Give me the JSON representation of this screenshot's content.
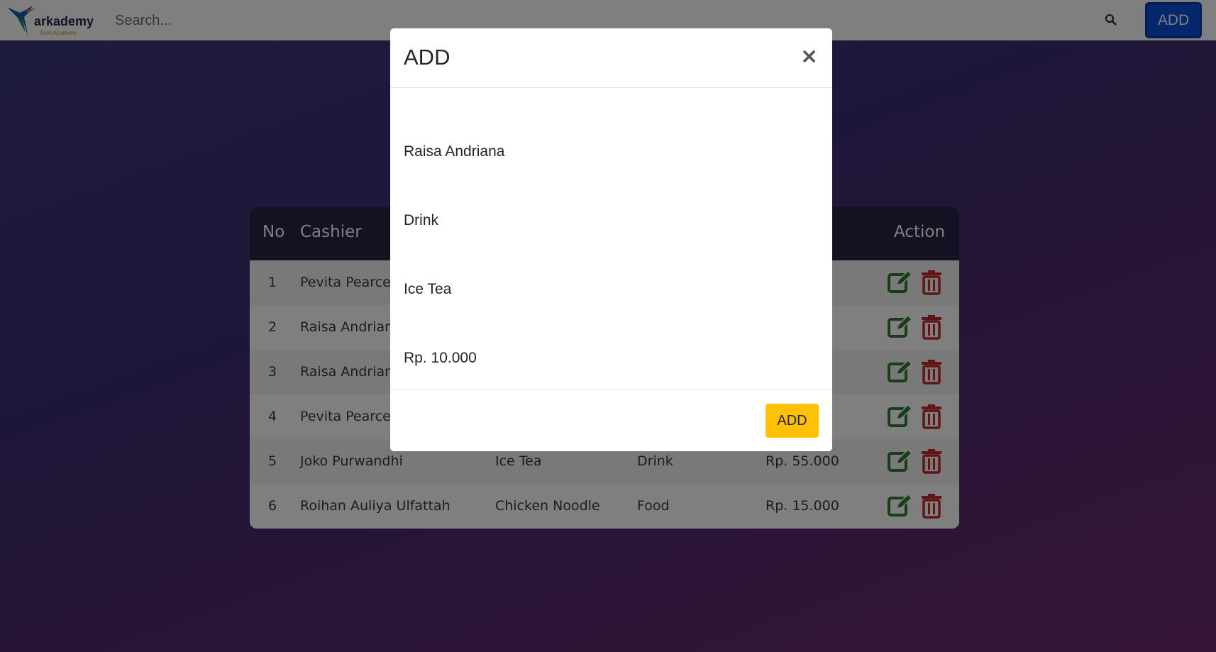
{
  "navbar": {
    "logo_text": "arkademy",
    "logo_sub": "Tech Academy",
    "search_placeholder": "Search...",
    "add_label": "ADD"
  },
  "table": {
    "headers": {
      "no": "No",
      "cashier": "Cashier",
      "action": "Action"
    },
    "rows": [
      {
        "no": "1",
        "cashier": "Pevita Pearce",
        "product": "",
        "category": "",
        "price": ""
      },
      {
        "no": "2",
        "cashier": "Raisa Andriana",
        "product": "",
        "category": "",
        "price": ""
      },
      {
        "no": "3",
        "cashier": "Raisa Andriana",
        "product": "",
        "category": "",
        "price": ""
      },
      {
        "no": "4",
        "cashier": "Pevita Pearce",
        "product": "",
        "category": "",
        "price": ""
      },
      {
        "no": "5",
        "cashier": "Joko Purwandhi",
        "product": "Ice Tea",
        "category": "Drink",
        "price": "Rp. 55.000"
      },
      {
        "no": "6",
        "cashier": "Roihan Auliya Ulfattah",
        "product": "Chicken Noodle",
        "category": "Food",
        "price": "Rp. 15.000"
      }
    ]
  },
  "modal": {
    "title": "ADD",
    "close": "×",
    "cashier": "Raisa Andriana",
    "category": "Drink",
    "product": "Ice Tea",
    "price": "Rp. 10.000",
    "add_label": "ADD"
  },
  "colors": {
    "edit_icon": "#2e7d32",
    "delete_icon": "#c62828",
    "nav_button": "#0b4fd6",
    "modal_button": "#ffc107"
  }
}
